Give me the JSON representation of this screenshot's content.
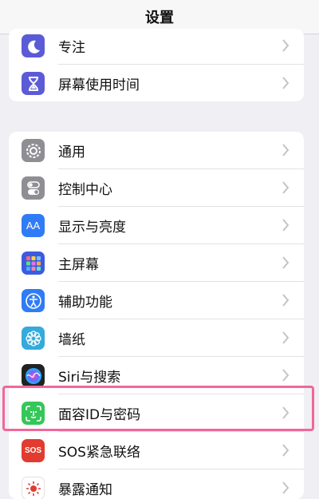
{
  "header": {
    "title": "设置"
  },
  "group1": [
    {
      "label": "专注",
      "icon": "moon-icon",
      "color": "#5c5bd6"
    },
    {
      "label": "屏幕使用时间",
      "icon": "hourglass-icon",
      "color": "#5c5bd6"
    }
  ],
  "group2": [
    {
      "label": "通用",
      "icon": "gear-icon",
      "color": "#8e8e93"
    },
    {
      "label": "控制中心",
      "icon": "toggles-icon",
      "color": "#8e8e93"
    },
    {
      "label": "显示与亮度",
      "icon": "aa-text-icon",
      "color": "#2f7cf6",
      "glyph": "AA"
    },
    {
      "label": "主屏幕",
      "icon": "app-grid-icon",
      "color": "#3b5be0"
    },
    {
      "label": "辅助功能",
      "icon": "accessibility-icon",
      "color": "#2f7cf6"
    },
    {
      "label": "墙纸",
      "icon": "flower-icon",
      "color": "#35aadc"
    },
    {
      "label": "Siri与搜索",
      "icon": "siri-icon",
      "color": "#222222"
    },
    {
      "label": "面容ID与密码",
      "icon": "face-id-icon",
      "color": "#34c759"
    },
    {
      "label": "SOS紧急联络",
      "icon": "sos-icon",
      "color": "#e23b30",
      "glyph": "SOS"
    },
    {
      "label": "暴露通知",
      "icon": "exposure-icon",
      "color": "#ffffff"
    }
  ]
}
